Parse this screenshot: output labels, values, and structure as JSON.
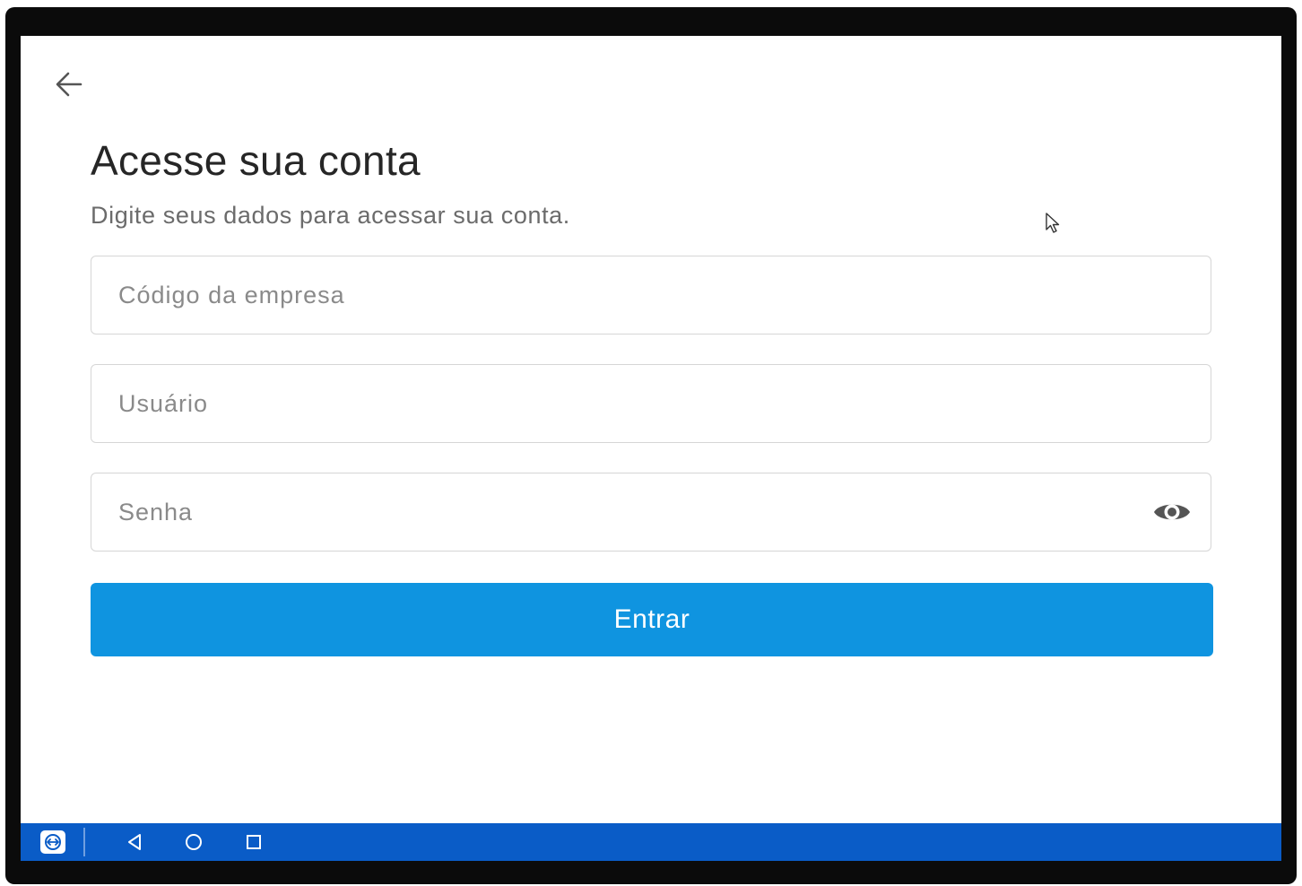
{
  "header": {
    "back_icon": "arrow-left-icon"
  },
  "login": {
    "title": "Acesse sua conta",
    "subtitle": "Digite seus dados para acessar sua conta.",
    "company_field": {
      "placeholder": "Código da empresa",
      "value": ""
    },
    "user_field": {
      "placeholder": "Usuário",
      "value": ""
    },
    "password_field": {
      "placeholder": "Senha",
      "value": "",
      "toggle_icon": "eye-icon"
    },
    "submit_label": "Entrar"
  },
  "navbar": {
    "items": [
      "remote-control-icon",
      "back-triangle-icon",
      "home-circle-icon",
      "recents-square-icon"
    ]
  },
  "colors": {
    "primary_button": "#0f94e0",
    "navbar": "#0a5cc7",
    "device_frame": "#0b0b0b",
    "title_text": "#262626",
    "subtitle_text": "#6b6b6b",
    "placeholder_text": "#8a8a8a",
    "field_border": "#d6d6d6"
  }
}
